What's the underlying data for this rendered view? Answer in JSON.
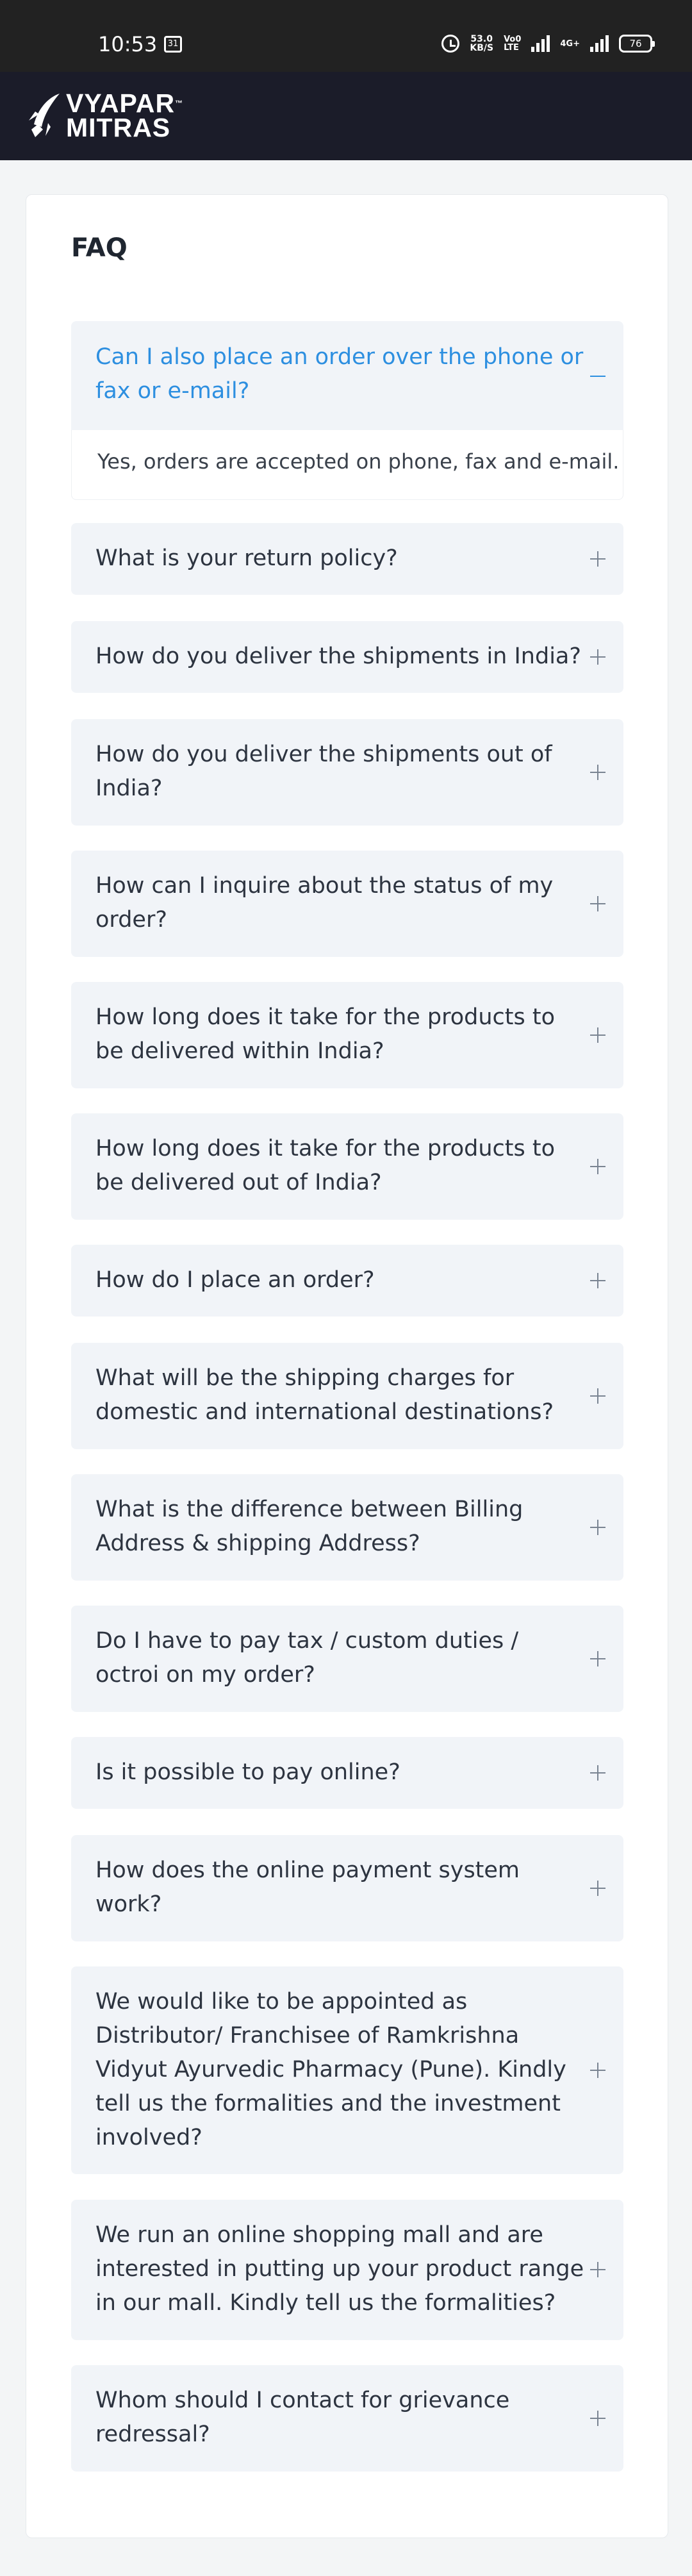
{
  "status_bar": {
    "time": "10:53",
    "calendar_badge": "31",
    "net_speed_value": "53.0",
    "net_speed_unit": "KB/S",
    "volte_top": "Vo0",
    "volte_bottom": "LTE",
    "network_type": "4G+",
    "battery": "76"
  },
  "header": {
    "logo_line1": "VYAPAR",
    "logo_line2": "MITRAS",
    "logo_tm": "™"
  },
  "faq": {
    "title": "FAQ",
    "items": [
      {
        "question": "Can I also place an order over the phone or fax or e-mail?",
        "answer": "Yes, orders are accepted on phone, fax and e-mail."
      },
      {
        "question": "What is your return policy?"
      },
      {
        "question": "How do you deliver the shipments in India?"
      },
      {
        "question": "How do you deliver the shipments out of India?"
      },
      {
        "question": "How can I inquire about the status of my order?"
      },
      {
        "question": "How long does it take for the products to be delivered within India?"
      },
      {
        "question": "How long does it take for the products to be delivered out of India?"
      },
      {
        "question": "How do I place an order?"
      },
      {
        "question": "What will be the shipping charges for domestic and international destinations?"
      },
      {
        "question": "What is the difference between Billing Address & shipping Address?"
      },
      {
        "question": "Do I have to pay tax / custom duties / octroi on my order?"
      },
      {
        "question": "Is it possible to pay online?"
      },
      {
        "question": "How does the online payment system work?"
      },
      {
        "question": "We would like to be appointed as Distributor/ Franchisee of Ramkrishna Vidyut Ayurvedic Pharmacy (Pune). Kindly tell us the formalities and the investment involved?"
      },
      {
        "question": "We run an online shopping mall and are interested in putting up your product range in our mall. Kindly tell us the formalities?"
      },
      {
        "question": "Whom should I contact for grievance redressal?"
      }
    ]
  }
}
